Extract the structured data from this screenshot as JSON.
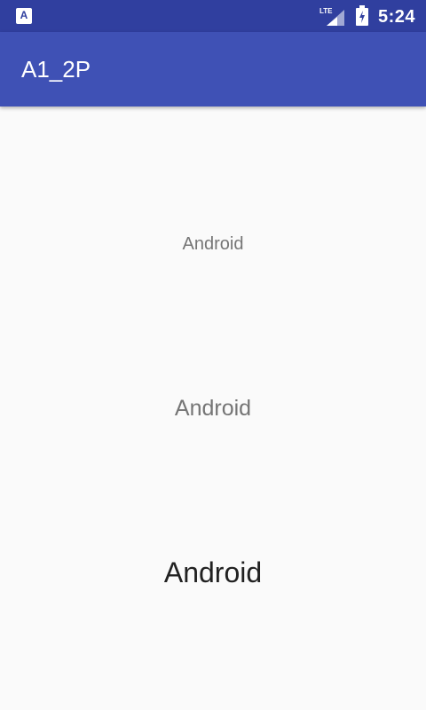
{
  "status_bar": {
    "left_icon": "app-notification-icon",
    "network_label": "LTE",
    "battery_icon": "battery-charging-icon",
    "time": "5:24",
    "background_color": "#303f9f"
  },
  "app_bar": {
    "title": "A1_2P",
    "background_color": "#3f51b5"
  },
  "content": {
    "labels": [
      "Android",
      "Android",
      "Android"
    ],
    "background_color": "#fafafa"
  }
}
